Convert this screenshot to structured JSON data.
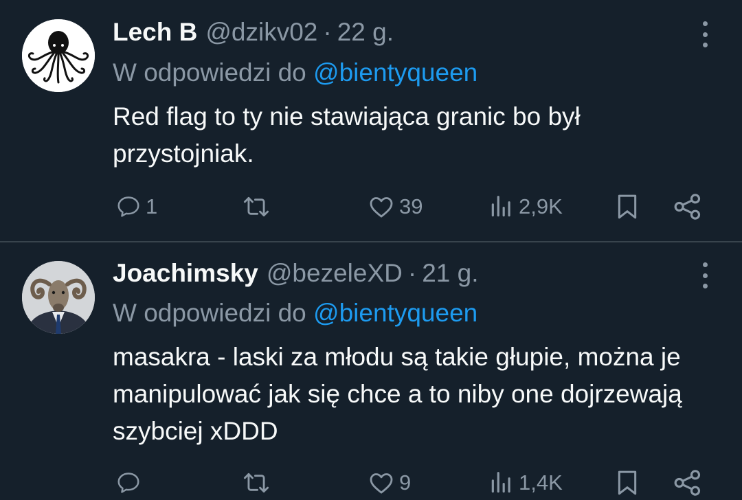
{
  "tweets": [
    {
      "display_name": "Lech B",
      "handle": "@dzikv02",
      "separator": "·",
      "time": "22 g.",
      "reply_prefix": "W odpowiedzi do",
      "reply_mention": "@bientyqueen",
      "text": "Red flag to ty nie stawiająca granic bo był przystojniak.",
      "stats": {
        "replies": "1",
        "retweets": "",
        "likes": "39",
        "views": "2,9K"
      }
    },
    {
      "display_name": "Joachimsky",
      "handle": "@bezeleXD",
      "separator": "·",
      "time": "21 g.",
      "reply_prefix": "W odpowiedzi do",
      "reply_mention": "@bientyqueen",
      "text": "masakra - laski za młodu są takie głupie, można je manipulować jak się chce a to niby one dojrzewają szybciej xDDD",
      "stats": {
        "replies": "",
        "retweets": "",
        "likes": "9",
        "views": "1,4K"
      }
    }
  ],
  "icons": {
    "reply": "reply-icon",
    "retweet": "retweet-icon",
    "like": "heart-icon",
    "views": "views-icon",
    "bookmark": "bookmark-icon",
    "share": "share-icon",
    "more": "more-icon"
  },
  "colors": {
    "background": "#15202b",
    "text": "#f7f9f9",
    "secondary": "#8b98a5",
    "accent": "#1d9bf0",
    "divider": "#38444d"
  }
}
